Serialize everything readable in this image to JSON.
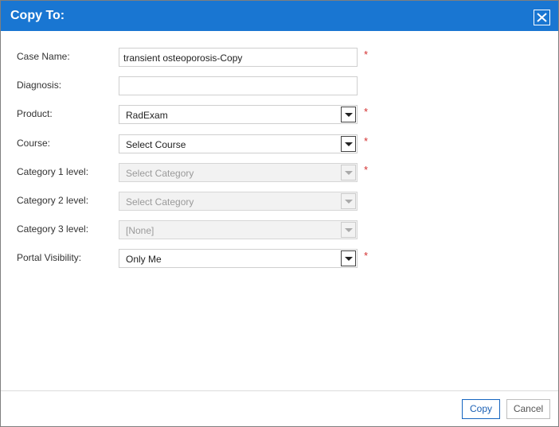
{
  "dialog": {
    "title": "Copy To:",
    "close_icon": "close-icon"
  },
  "colors": {
    "titlebar": "#1976d2",
    "required": "#d32f2f",
    "primary_button_border": "#1565c0"
  },
  "form": {
    "case_name": {
      "label": "Case Name:",
      "value": "transient osteoporosis-Copy",
      "required": "*"
    },
    "diagnosis": {
      "label": "Diagnosis:",
      "value": ""
    },
    "product": {
      "label": "Product:",
      "value": "RadExam",
      "required": "*"
    },
    "course": {
      "label": "Course:",
      "value": "Select Course",
      "required": "*"
    },
    "category1": {
      "label": "Category 1 level:",
      "value": "Select Category",
      "required": "*"
    },
    "category2": {
      "label": "Category 2 level:",
      "value": "Select Category"
    },
    "category3": {
      "label": "Category 3 level:",
      "value": "[None]"
    },
    "portal_visibility": {
      "label": "Portal Visibility:",
      "value": "Only Me",
      "required": "*"
    }
  },
  "footer": {
    "copy_label": "Copy",
    "cancel_label": "Cancel"
  }
}
